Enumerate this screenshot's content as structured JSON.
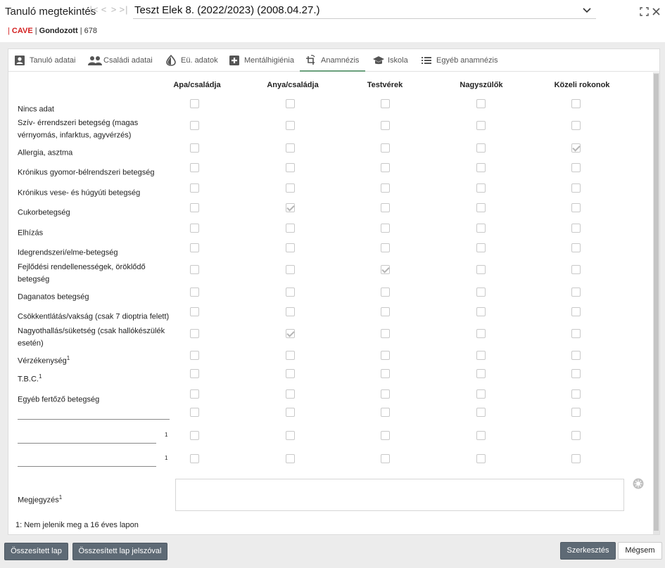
{
  "window": {
    "title": "Tanuló megtekintés",
    "nav": [
      "|<",
      "<",
      ">",
      ">|"
    ],
    "selector_value": "Teszt Elek 8. (2022/2023) (2008.04.27.)"
  },
  "status": {
    "cave": "CAVE",
    "gondozott": "Gondozott",
    "id": "678"
  },
  "tabs": [
    {
      "label": "Tanuló adatai",
      "icon": "id-card-icon"
    },
    {
      "label": "Családi adatai",
      "icon": "people-icon"
    },
    {
      "label": "Eü. adatok",
      "icon": "drop-icon"
    },
    {
      "label": "Mentálhigiénia",
      "icon": "plus-box-icon"
    },
    {
      "label": "Anamnézis",
      "icon": "crop-rotate-icon"
    },
    {
      "label": "Iskola",
      "icon": "school-cap-icon"
    },
    {
      "label": "Egyéb anamnézis",
      "icon": "list-icon"
    }
  ],
  "columns": [
    "Apa/családja",
    "Anya/családja",
    "Testvérek",
    "Nagyszülők",
    "Közeli rokonok"
  ],
  "rows": [
    {
      "label": "Nincs adat",
      "sup": "",
      "checks": [
        false,
        false,
        false,
        false,
        false
      ]
    },
    {
      "label": "Szív- érrendszeri betegség (magas vérnyomás, infarktus, agyvérzés)",
      "sup": "",
      "checks": [
        false,
        false,
        false,
        false,
        false
      ]
    },
    {
      "label": "Allergia, asztma",
      "sup": "",
      "checks": [
        false,
        false,
        false,
        false,
        true
      ]
    },
    {
      "label": "Krónikus gyomor-bélrendszeri betegség",
      "sup": "",
      "checks": [
        false,
        false,
        false,
        false,
        false
      ]
    },
    {
      "label": "Krónikus vese- és húgyúti betegség",
      "sup": "",
      "checks": [
        false,
        false,
        false,
        false,
        false
      ]
    },
    {
      "label": "Cukorbetegség",
      "sup": "",
      "checks": [
        false,
        true,
        false,
        false,
        false
      ]
    },
    {
      "label": "Elhízás",
      "sup": "",
      "checks": [
        false,
        false,
        false,
        false,
        false
      ]
    },
    {
      "label": "Idegrendszeri/elme-betegség",
      "sup": "",
      "checks": [
        false,
        false,
        false,
        false,
        false
      ]
    },
    {
      "label": "Fejlődési rendellenességek, öröklődő betegség",
      "sup": "",
      "checks": [
        false,
        false,
        true,
        false,
        false
      ]
    },
    {
      "label": "Daganatos betegség",
      "sup": "",
      "checks": [
        false,
        false,
        false,
        false,
        false
      ]
    },
    {
      "label": "Csökkentlátás/vakság (csak 7 dioptria felett)",
      "sup": "",
      "checks": [
        false,
        false,
        false,
        false,
        false
      ]
    },
    {
      "label": "Nagyothallás/süketség (csak hallókészülék esetén)",
      "sup": "",
      "checks": [
        false,
        true,
        false,
        false,
        false
      ]
    },
    {
      "label": "Vérzékenység",
      "sup": "1",
      "checks": [
        false,
        false,
        false,
        false,
        false
      ]
    },
    {
      "label": "T.B.C.",
      "sup": "1",
      "checks": [
        false,
        false,
        false,
        false,
        false
      ]
    },
    {
      "label": "Egyéb fertőző betegség",
      "sup": "",
      "checks": [
        false,
        false,
        false,
        false,
        false
      ]
    }
  ],
  "custom_rows": [
    {
      "value": "",
      "sup": "",
      "checks": [
        false,
        false,
        false,
        false,
        false
      ]
    },
    {
      "value": "",
      "sup": "1",
      "checks": [
        false,
        false,
        false,
        false,
        false
      ]
    },
    {
      "value": "",
      "sup": "1",
      "checks": [
        false,
        false,
        false,
        false,
        false
      ]
    }
  ],
  "note": {
    "label": "Megjegyzés",
    "sup": "1",
    "value": ""
  },
  "footnote": "1: Nem jelenik meg a 16 éves lapon",
  "buttons": {
    "summary": "Összesített lap",
    "summary_pw": "Összesített lap jelszóval",
    "edit": "Szerkesztés",
    "cancel": "Mégsem"
  }
}
